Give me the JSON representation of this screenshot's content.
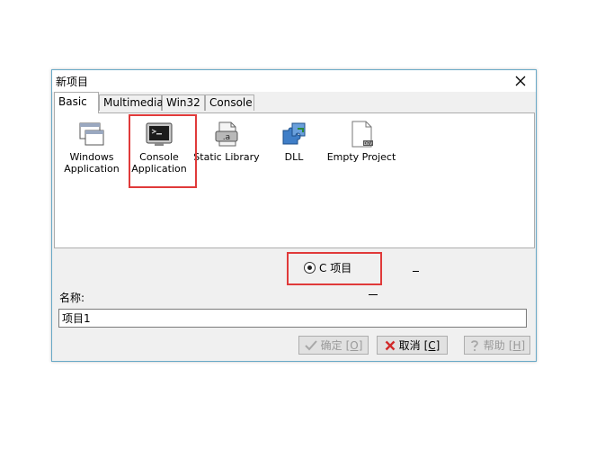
{
  "dialog": {
    "title": "新项目",
    "tabs": [
      {
        "label": "Basic"
      },
      {
        "label": "Multimedia"
      },
      {
        "label": "Win32"
      },
      {
        "label": "Console"
      }
    ],
    "templates": [
      {
        "label": "Windows\nApplication",
        "icon": "windows-app-icon"
      },
      {
        "label": "Console\nApplication",
        "icon": "console-app-icon"
      },
      {
        "label": "Static Library",
        "icon": "static-library-icon"
      },
      {
        "label": "DLL",
        "icon": "dll-puzzle-icon"
      },
      {
        "label": "Empty Project",
        "icon": "empty-project-icon"
      }
    ],
    "language_option": {
      "label": "C 项目",
      "selected": true
    },
    "name_label": "名称:",
    "name_value": "项目1",
    "buttons": {
      "ok": {
        "label": "确定",
        "shortcut": "[O]",
        "enabled": false
      },
      "cancel": {
        "label": "取消",
        "shortcut": "[C]",
        "enabled": true
      },
      "help": {
        "label": "帮助",
        "shortcut": "[H]",
        "enabled": false
      }
    },
    "colors": {
      "highlight": "#e03a3a",
      "border": "#68a9c7"
    }
  }
}
